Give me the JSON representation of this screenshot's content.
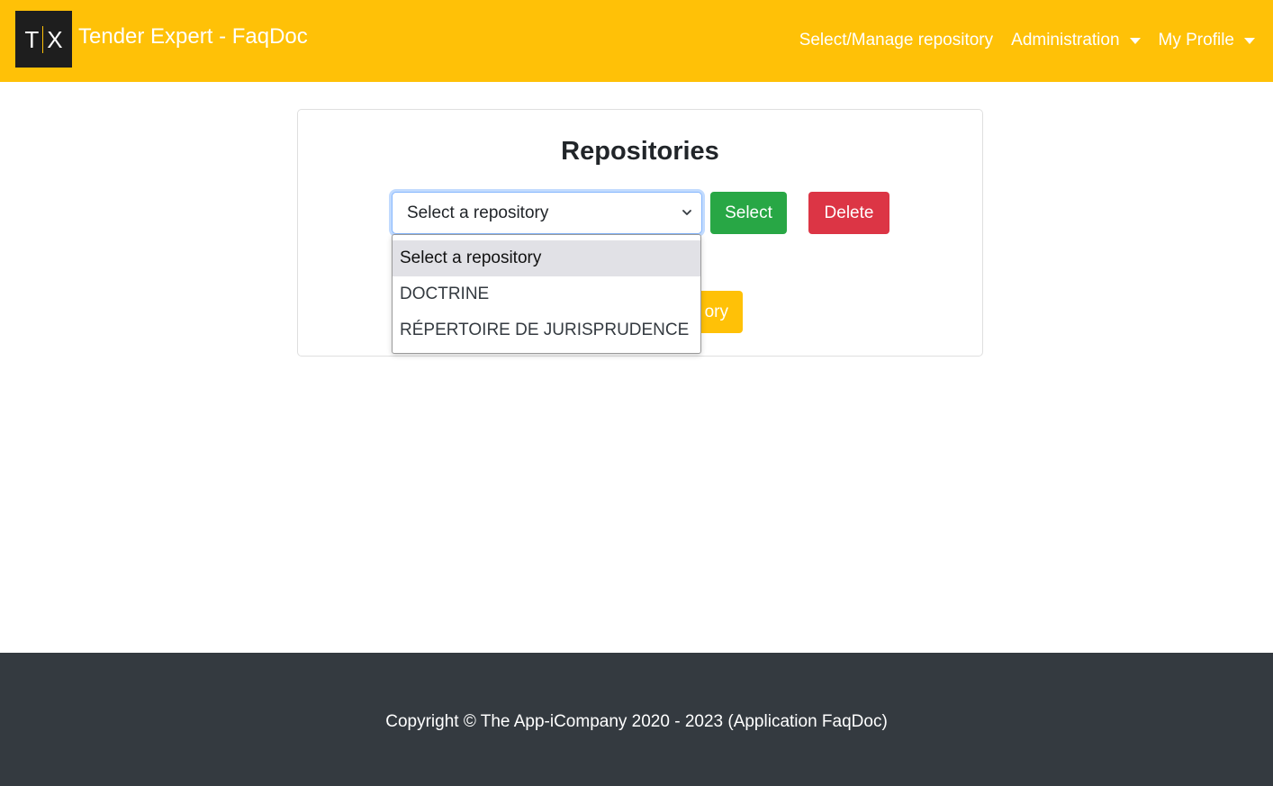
{
  "header": {
    "logo": {
      "icon": "tx-logo-icon",
      "letters": [
        "T",
        "X"
      ]
    },
    "brand_title": "Tender Expert - FaqDoc",
    "nav": [
      {
        "label": "Select/Manage repository",
        "dropdown": false
      },
      {
        "label": "Administration",
        "dropdown": true
      },
      {
        "label": "My Profile",
        "dropdown": true
      }
    ],
    "color": "#ffc107"
  },
  "repositories": {
    "title": "Repositories",
    "select": {
      "value": "Select a repository",
      "options": [
        "Select a repository",
        "DOCTRINE",
        "RÉPERTOIRE DE JURISPRUDENCE"
      ],
      "selected_index": 0,
      "open": true
    },
    "select_button": "Select",
    "delete_button": "Delete",
    "create_button_visible_fragment": "ory"
  },
  "footer": {
    "text": "Copyright © The App-iCompany 2020 - 2023 (Application FaqDoc)"
  },
  "colors": {
    "accent": "#ffc107",
    "success": "#28a745",
    "danger": "#dc3545",
    "footer": "#343a40"
  }
}
